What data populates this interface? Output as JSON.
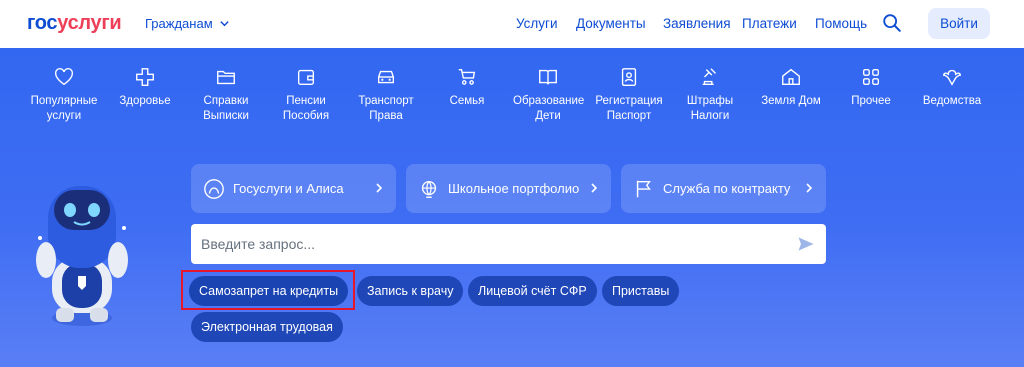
{
  "header": {
    "logo_part1": "гос",
    "logo_part2": "услуги",
    "audience": "Гражданам",
    "nav": [
      "Услуги",
      "Документы",
      "Заявления",
      "Платежи",
      "Помощь"
    ],
    "login": "Войти"
  },
  "categories": [
    {
      "label": "Популярные услуги",
      "icon": "heart-icon"
    },
    {
      "label": "Здоровье",
      "icon": "medical-cross-icon"
    },
    {
      "label": "Справки Выписки",
      "icon": "folder-icon"
    },
    {
      "label": "Пенсии Пособия",
      "icon": "wallet-icon"
    },
    {
      "label": "Транспорт Права",
      "icon": "car-icon"
    },
    {
      "label": "Семья",
      "icon": "stroller-icon"
    },
    {
      "label": "Образование Дети",
      "icon": "book-icon"
    },
    {
      "label": "Регистрация Паспорт",
      "icon": "id-card-icon"
    },
    {
      "label": "Штрафы Налоги",
      "icon": "gavel-icon"
    },
    {
      "label": "Земля Дом",
      "icon": "house-icon"
    },
    {
      "label": "Прочее",
      "icon": "grid-icon"
    },
    {
      "label": "Ведомства",
      "icon": "emblem-icon"
    }
  ],
  "promos": [
    {
      "label": "Госуслуги и Алиса",
      "icon": "alice-icon"
    },
    {
      "label": "Школьное портфолио",
      "icon": "globe-icon"
    },
    {
      "label": "Служба по контракту",
      "icon": "flag-icon"
    }
  ],
  "search": {
    "placeholder": "Введите запрос..."
  },
  "chips": [
    "Самозапрет на кредиты",
    "Запись к врачу",
    "Лицевой счёт СФР",
    "Приставы",
    "Электронная трудовая"
  ],
  "colors": {
    "brand_blue": "#0d4cd3",
    "brand_red": "#ee3f58",
    "hero_blue": "#3267f1",
    "chip": "#1f47b8",
    "highlight": "#e8162d"
  }
}
